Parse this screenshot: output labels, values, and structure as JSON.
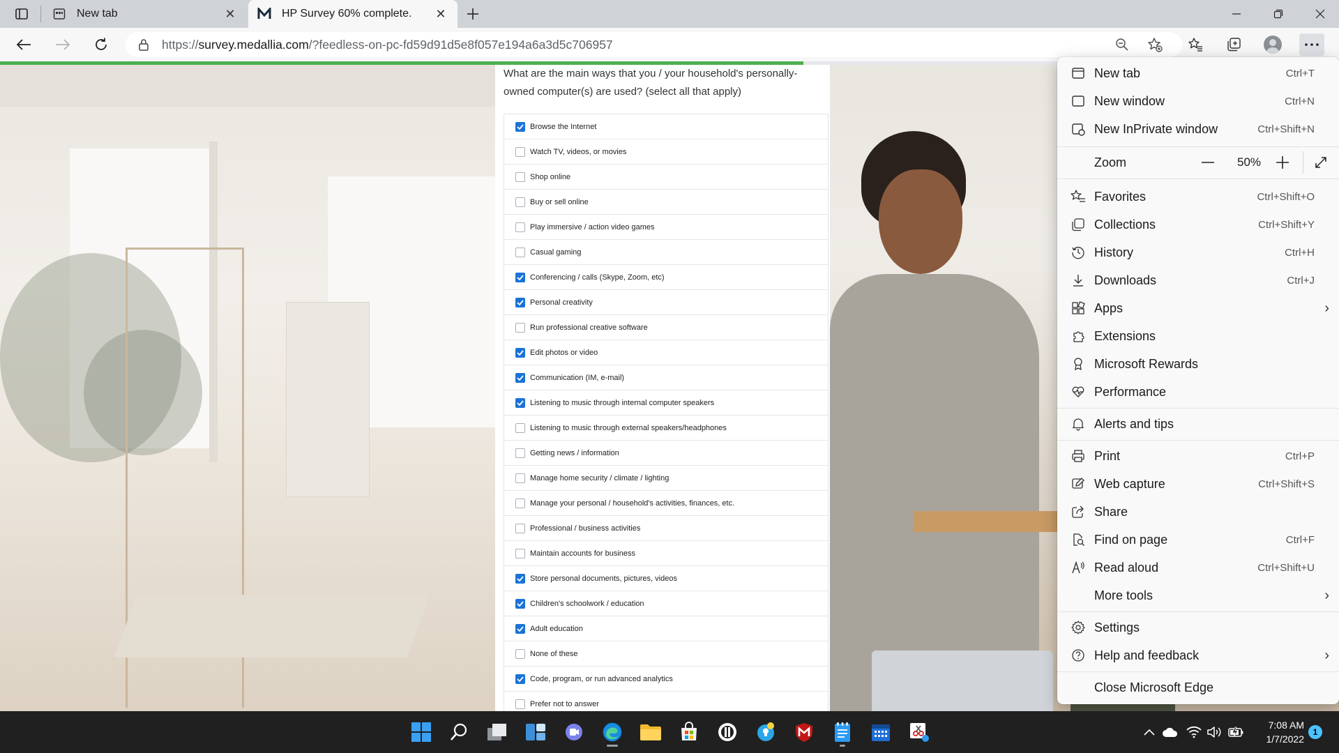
{
  "browser": {
    "tabs": [
      {
        "title": "New tab",
        "icon": "new-tab-page-icon"
      },
      {
        "title": "HP Survey 60% complete.",
        "icon": "medallia-logo-icon"
      }
    ],
    "address": {
      "url_prefix": "https://",
      "url_host": "survey.medallia.com",
      "url_path": "/?feedless-on-pc-fd59d91d5e8f057e194a6a3d5c706957"
    },
    "page_progress": 0.6,
    "accent_color": "#4caf50"
  },
  "survey": {
    "question": "What are the main ways that you / your household's personally-owned computer(s) are used? (select all that apply)",
    "options": [
      {
        "label": "Browse the Internet",
        "checked": true
      },
      {
        "label": "Watch TV, videos, or movies",
        "checked": false
      },
      {
        "label": "Shop online",
        "checked": false
      },
      {
        "label": "Buy or sell online",
        "checked": false
      },
      {
        "label": "Play immersive / action video games",
        "checked": false
      },
      {
        "label": "Casual gaming",
        "checked": false
      },
      {
        "label": "Conferencing / calls (Skype, Zoom, etc)",
        "checked": true
      },
      {
        "label": "Personal creativity",
        "checked": true
      },
      {
        "label": "Run professional creative software",
        "checked": false
      },
      {
        "label": "Edit photos or video",
        "checked": true
      },
      {
        "label": "Communication (IM, e-mail)",
        "checked": true
      },
      {
        "label": "Listening to music through internal computer speakers",
        "checked": true
      },
      {
        "label": "Listening to music through external speakers/headphones",
        "checked": false
      },
      {
        "label": "Getting news / information",
        "checked": false
      },
      {
        "label": "Manage home security / climate / lighting",
        "checked": false
      },
      {
        "label": "Manage your personal / household's activities, finances, etc.",
        "checked": false
      },
      {
        "label": "Professional / business activities",
        "checked": false
      },
      {
        "label": "Maintain accounts for business",
        "checked": false
      },
      {
        "label": "Store personal documents, pictures, videos",
        "checked": true
      },
      {
        "label": "Children's schoolwork / education",
        "checked": true
      },
      {
        "label": "Adult education",
        "checked": true
      },
      {
        "label": "None of these",
        "checked": false
      },
      {
        "label": "Code, program, or run advanced analytics",
        "checked": true
      },
      {
        "label": "Prefer not to answer",
        "checked": false
      }
    ]
  },
  "menu": {
    "new_tab": {
      "label": "New tab",
      "shortcut": "Ctrl+T",
      "icon": "new-tab-icon"
    },
    "new_window": {
      "label": "New window",
      "shortcut": "Ctrl+N",
      "icon": "new-window-icon"
    },
    "new_inprivate": {
      "label": "New InPrivate window",
      "shortcut": "Ctrl+Shift+N",
      "icon": "inprivate-icon"
    },
    "zoom": {
      "label": "Zoom",
      "value": "50%",
      "minus": "—",
      "plus": "+"
    },
    "favorites": {
      "label": "Favorites",
      "shortcut": "Ctrl+Shift+O",
      "icon": "favorites-icon"
    },
    "collections": {
      "label": "Collections",
      "shortcut": "Ctrl+Shift+Y",
      "icon": "collections-icon"
    },
    "history": {
      "label": "History",
      "shortcut": "Ctrl+H",
      "icon": "history-icon"
    },
    "downloads": {
      "label": "Downloads",
      "shortcut": "Ctrl+J",
      "icon": "download-icon"
    },
    "apps": {
      "label": "Apps",
      "icon": "apps-icon"
    },
    "extensions": {
      "label": "Extensions",
      "icon": "extensions-icon"
    },
    "rewards": {
      "label": "Microsoft Rewards",
      "icon": "rewards-icon"
    },
    "performance": {
      "label": "Performance",
      "icon": "performance-icon"
    },
    "alerts": {
      "label": "Alerts and tips",
      "icon": "bell-icon"
    },
    "print": {
      "label": "Print",
      "shortcut": "Ctrl+P",
      "icon": "print-icon"
    },
    "web_capture": {
      "label": "Web capture",
      "shortcut": "Ctrl+Shift+S",
      "icon": "web-capture-icon"
    },
    "share": {
      "label": "Share",
      "icon": "share-icon"
    },
    "find": {
      "label": "Find on page",
      "shortcut": "Ctrl+F",
      "icon": "find-icon"
    },
    "read_aloud": {
      "label": "Read aloud",
      "shortcut": "Ctrl+Shift+U",
      "icon": "read-aloud-icon"
    },
    "more_tools": {
      "label": "More tools"
    },
    "settings": {
      "label": "Settings",
      "icon": "gear-icon"
    },
    "help": {
      "label": "Help and feedback",
      "icon": "help-icon"
    },
    "close": {
      "label": "Close Microsoft Edge"
    }
  },
  "taskbar": {
    "time": "7:08 AM",
    "date": "1/7/2022",
    "notification_count": "1"
  }
}
